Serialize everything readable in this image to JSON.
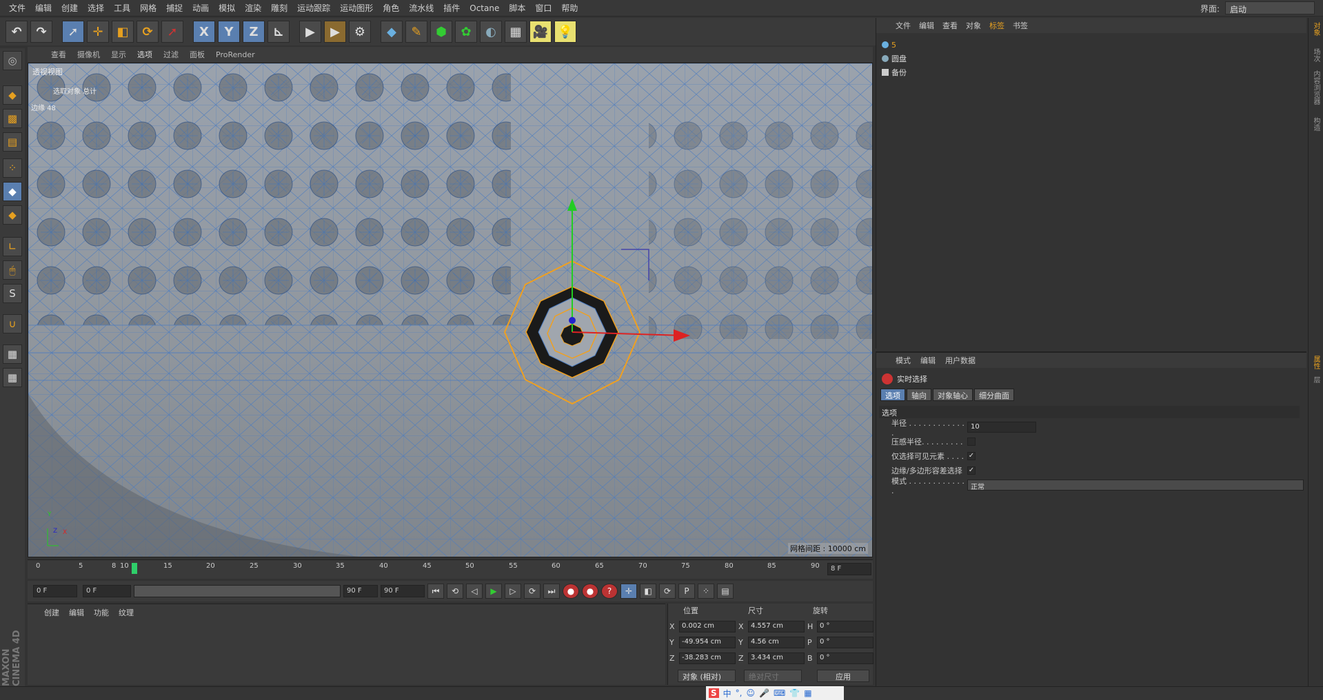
{
  "menu": [
    "文件",
    "编辑",
    "创建",
    "选择",
    "工具",
    "网格",
    "捕捉",
    "动画",
    "模拟",
    "渲染",
    "雕刻",
    "运动跟踪",
    "运动图形",
    "角色",
    "流水线",
    "插件",
    "Octane",
    "脚本",
    "窗口",
    "帮助"
  ],
  "layout": {
    "label": "界面:",
    "value": "启动"
  },
  "toolbar": {
    "x": "X",
    "y": "Y",
    "z": "Z"
  },
  "viewport": {
    "menu": [
      "查看",
      "摄像机",
      "显示",
      "选项",
      "过滤",
      "面板",
      "ProRender"
    ],
    "name": "透视视图",
    "info1": "选取对象  总计",
    "info2": "边缘  48",
    "grid_spacing": "网格间距 : 10000 cm",
    "axis_y": "Y",
    "axis_z": "Z",
    "axis_x": "X"
  },
  "timeline": {
    "ticks": [
      "0",
      "5",
      "8",
      "10",
      "15",
      "20",
      "25",
      "30",
      "35",
      "40",
      "45",
      "50",
      "55",
      "60",
      "65",
      "70",
      "75",
      "80",
      "85",
      "90"
    ],
    "current_frame": "8 F"
  },
  "transport": {
    "start": "0 F",
    "range_start": "0 F",
    "range_end": "90 F",
    "end": "90 F"
  },
  "material": {
    "menu": [
      "创建",
      "编辑",
      "功能",
      "纹理"
    ]
  },
  "coords": {
    "headers": {
      "pos": "位置",
      "size": "尺寸",
      "rot": "旋转"
    },
    "rows": [
      {
        "axis": "X",
        "pos": "0.002 cm",
        "saxis": "X",
        "size": "4.557 cm",
        "raxis": "H",
        "rot": "0 °"
      },
      {
        "axis": "Y",
        "pos": "-49.954 cm",
        "saxis": "Y",
        "size": "4.56 cm",
        "raxis": "P",
        "rot": "0 °"
      },
      {
        "axis": "Z",
        "pos": "-38.283 cm",
        "saxis": "Z",
        "size": "3.434 cm",
        "raxis": "B",
        "rot": "0 °"
      }
    ],
    "mode": "对象 (相对)",
    "size_mode": "绝对尺寸",
    "apply": "应用"
  },
  "brand": "MAXON CINEMA 4D",
  "objects": {
    "menu": [
      "文件",
      "编辑",
      "查看",
      "对象",
      "标签",
      "书签"
    ],
    "items": [
      "5",
      "圆盘",
      "备份"
    ]
  },
  "attributes": {
    "menu": [
      "模式",
      "编辑",
      "用户数据"
    ],
    "tool": "实时选择",
    "tabs": [
      "选项",
      "轴向",
      "对象轴心",
      "细分曲面"
    ],
    "section": "选项",
    "radius_label": "半径 . . . . . . . . . . . . .",
    "radius": "10",
    "pressure_label": "压感半径. . . . . . . . .",
    "visible_label": "仅选择可见元素 . . . .",
    "edge_label": "边缘/多边形容差选择",
    "mode_label": "模式 . . . . . . . . . . . . .",
    "mode": "正常",
    "check": "✓"
  },
  "sidetabs": [
    "对象",
    "场次",
    "内容浏览器",
    "构造",
    "属性",
    "层"
  ],
  "ime": {
    "s": "S",
    "zh": "中",
    "punct": "°,"
  }
}
